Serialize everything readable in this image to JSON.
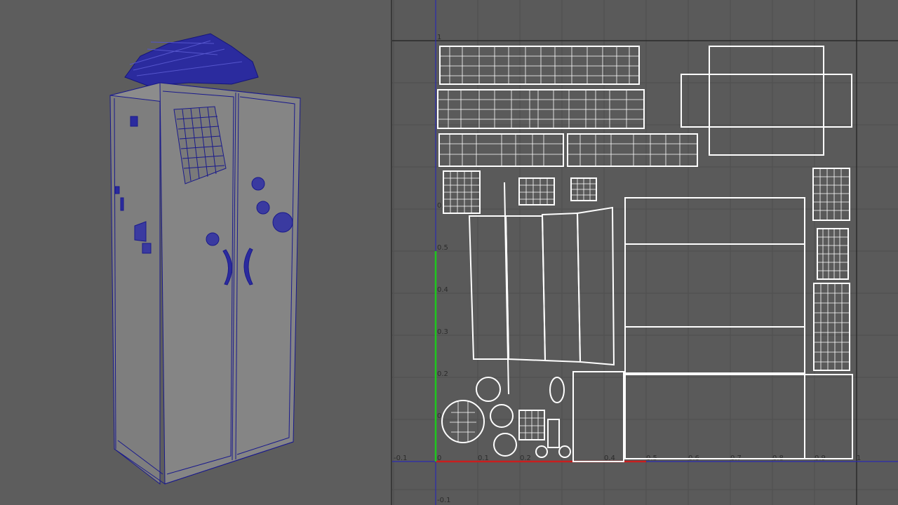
{
  "viewport3d": {
    "object": "locker-wireframe-model",
    "wire_color": "#1a1a8c",
    "fill_color": "#858585",
    "background": "#5d5d5d"
  },
  "uv_editor": {
    "background": "#5a5a5a",
    "grid_color": "#4f4f4f",
    "shell_color": "#ffffff",
    "u_axis_color": "#c81e1e",
    "v_axis_color": "#1ec81e",
    "labels": {
      "v_1": "1",
      "v_0_6": "0.",
      "v_0_5": "0.5",
      "v_0_4": "0.4",
      "v_0_3": "0.3",
      "v_0_2": "0.2",
      "v_0_1": "0.",
      "v_neg": "-0.1",
      "u_neg": "-0.1",
      "u_0": "0",
      "u_0_1": "0.1",
      "u_0_2": "0.2",
      "u_0_4": "0.4",
      "u_0_5": "0.5",
      "u_0_6": "0.6",
      "u_0_7": "0.7",
      "u_0_8": "0.8",
      "u_0_9": "0.9",
      "u_1": "1"
    }
  }
}
